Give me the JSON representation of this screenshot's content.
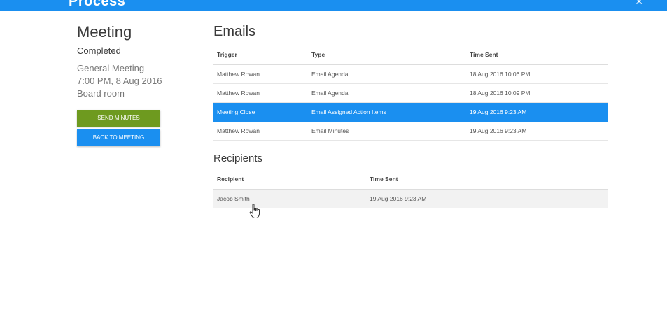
{
  "header": {
    "brand": "Process",
    "brand_suffix": "/",
    "icon": "user-icon"
  },
  "meeting": {
    "title": "Meeting",
    "status": "Completed",
    "name": "General Meeting",
    "datetime": "7:00 PM, 8 Aug 2016",
    "location": "Board room"
  },
  "actions": {
    "send_minutes": "SEND MINUTES",
    "back_to_meeting": "BACK TO MEETING"
  },
  "emails": {
    "title": "Emails",
    "columns": [
      "Trigger",
      "Type",
      "Time Sent"
    ],
    "rows": [
      [
        "Matthew Rowan",
        "Email Agenda",
        "18 Aug 2016 10:06 PM"
      ],
      [
        "Matthew Rowan",
        "Email Agenda",
        "18 Aug 2016 10:09 PM"
      ],
      [
        "Meeting Close",
        "Email Assigned Action Items",
        "19 Aug 2016 9:23 AM"
      ],
      [
        "Matthew Rowan",
        "Email Minutes",
        "19 Aug 2016 9:23 AM"
      ]
    ]
  },
  "recipients": {
    "title": "Recipients",
    "columns": [
      "Recipient",
      "Time Sent"
    ],
    "rows": [
      [
        "Jacob Smith",
        "19 Aug 2016 9:23 AM"
      ]
    ]
  },
  "colors": {
    "accent": "#1a8ff0",
    "success": "#6e9a1f"
  }
}
